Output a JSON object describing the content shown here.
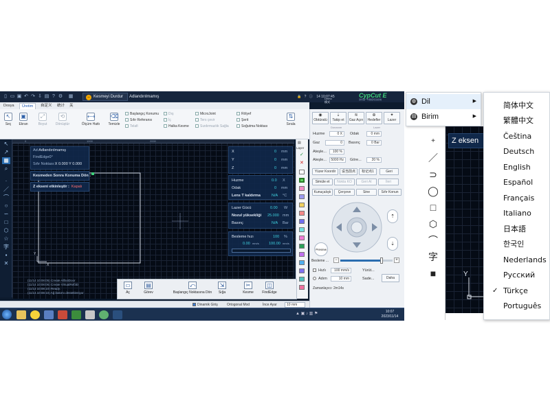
{
  "titlebar": {
    "stop_button": "Kesmeyi Durdur",
    "filename": "Adlandırılmamış",
    "clock": "14 10:07:45",
    "demo": "Demo模式",
    "brand": "CypCut E",
    "brand_sub": "激光第一代数控切割系统"
  },
  "menu_tabs": [
    "Dosya",
    "Üretim",
    "自定义",
    "统计",
    "关"
  ],
  "active_tab_index": 1,
  "ribbon": {
    "seç": "Seç",
    "ekran": "Ekran",
    "boyut": "Boyut",
    "donustur": "Dönüştür",
    "olcum": "Ölçüm Hattı",
    "temizle": "Temizle",
    "baslangic_konumu": "Başlangıç Konumu",
    "sifir_referansi": "Sıfır Referansı",
    "telafi": "Telafi",
    "dis": "Dış",
    "ic": "İç",
    "halka_kesme": "Halka Kesme",
    "microjoint": "MicroJoint",
    "ters_cevir": "Ters çevir",
    "sizdirmazlik": "Sızdırmazlık Sağla",
    "rolyef": "Rölyef",
    "serit": "Şerit",
    "sogutma": "Soğutma Noktası",
    "sirala": "Sırala"
  },
  "canvas_info": {
    "name_label": "Ad:",
    "name": "Adlandırılmamış",
    "findedge": "FindEdge0°",
    "zero_label": "Sıfır Noktası:",
    "zero": "X 0.000 Y 0.000",
    "return_label": "Kesmeden Sonra Konuma Dön :",
    "z_axis_label": "Z ekseni etkinleştir :",
    "z_axis_value": "Kapalı",
    "ruler_marks": [
      "0",
      "1000",
      "2000"
    ]
  },
  "coords": {
    "x_label": "X",
    "x_val": "0",
    "y_label": "Y",
    "y_val": "0",
    "z_label": "Z",
    "z_val": "0",
    "unit": "mm"
  },
  "head": {
    "huzme_label": "Huzme",
    "huzme_val": "0.0",
    "huzme_unit": "X",
    "odak_label": "Odak",
    "odak_val": "0",
    "odak_unit": "mm",
    "lens_label": "Lens T kaldırma",
    "lens_val": "N/A",
    "lens_unit": "°C"
  },
  "laser": {
    "guc_label": "Lazer Gücü",
    "guc_val": "0.00",
    "guc_unit": "W",
    "nozul_label": "Nozul yüksekliği",
    "nozul_val": "25.000",
    "nozul_unit": "mm",
    "basinc_label": "Basınç",
    "basinc_val": "N/A",
    "basinc_unit": "Bar"
  },
  "feed": {
    "label": "Besleme hızı",
    "pct": "100",
    "pct_unit": "%",
    "speed1": "0.00",
    "speed2": "100.00",
    "speed_unit": "mm/s"
  },
  "palette_label": "Layer",
  "bottom_buttons": [
    "Aç",
    "Görev",
    "Başlangıç Noktasına Dön",
    "Sığa",
    "Kesme",
    "FindEdge"
  ],
  "log_lines": [
    "(11/14 10:08:05) Create AllbotDoor",
    "(11/14 10:08:06) Create VirtualRef3D",
    "(11/14 10:08:10) Ready.",
    "(11/14 10:08:10) Ağ bakımı destekleniyor"
  ],
  "statusbar": {
    "dinamik": "Dinamik Giriş",
    "ortogonal": "Ortogonal Mod",
    "ince_ayar": "İnce Ayar",
    "step": "10 mm"
  },
  "right_panel": {
    "btn_obturatu": "Obtüratü",
    "btn_takip": "Takip et",
    "btn_gaz": "Gaz Açın",
    "btn_hedef": "Hedefler",
    "btn_lazer": "Lazer",
    "group1": "Donanım",
    "group2": "Lazer",
    "huzme_label": "Huzme",
    "huzme_val": "0 X",
    "odak_label": "Odak",
    "odak_val": "0 mm",
    "gaz_label": "Gaz",
    "gaz_val": "0",
    "basinc_label": "Basınç",
    "basinc_val": "0 Bar",
    "atesle_label": "Ateşle...",
    "atesle_val": "100 %",
    "atesle2_label": "Ateşle...",
    "atesle2_val": "5000 Hz",
    "gore_label": "Göre...",
    "gore_val": "20 %",
    "yuzer": "Yüzer Koordir",
    "geri": "Geri",
    "sim": "Simüle et",
    "nokta": "Nokta KO",
    "geri_al": "Geri Al",
    "ileri": "İleri",
    "kunu": "Kunuçalıştı",
    "cerceve": "Çerçeve",
    "sine": "Sine",
    "sifir_konun": "Sıfır Konun",
    "preview": "Preview",
    "besleme": "Besleme ...",
    "hizli": "Hızlı",
    "hizli_val": "100 mm/s",
    "yuru": "Yürüt...",
    "adim": "Adım",
    "adim_val": "10 mm",
    "sade": "Sade...",
    "daha": "Daha",
    "zaman": "Zamanlayıcı: 2m14s"
  },
  "taskbar_clock": "10:07 2023/11/14",
  "context_menu": {
    "dil": "Dil",
    "birim": "Birim"
  },
  "languages": [
    "简体中文",
    "繁體中文",
    "Čeština",
    "Deutsch",
    "English",
    "Español",
    "Français",
    "Italiano",
    "日本語",
    "한국인",
    "Nederlands",
    "Pусский",
    "Türkçe",
    "Português"
  ],
  "selected_language_index": 12,
  "zoom_canvas_label": "Z eksen",
  "zoom_tools": [
    "+",
    "／",
    "⊃",
    "◯",
    "□",
    "⬡",
    "⌒",
    "字",
    "■"
  ],
  "colors": {
    "app_bg": "#0d1b2e",
    "canvas_bg": "#050b15",
    "panel_bg": "#10284a",
    "accent_green": "#3fd07a",
    "stop_icon": "#f0a500"
  }
}
